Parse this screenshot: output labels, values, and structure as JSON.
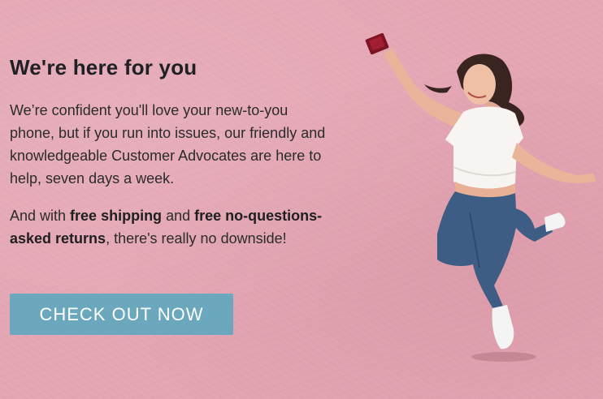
{
  "hero": {
    "heading": "We're here for you",
    "paragraph1": "We’re confident you'll love your new-to-you phone, but if you run into issues, our friendly and knowledgeable Customer Advocates are here to help, seven days a week.",
    "paragraph2": {
      "part1": "And with ",
      "bold1": "free shipping",
      "part2": " and ",
      "bold2": "free no-questions-asked returns",
      "part3": ", there's really no downside!"
    },
    "cta_label": "CHECK OUT NOW"
  },
  "image": {
    "semantic": "woman-jumping-taking-selfie-photo"
  },
  "colors": {
    "background": "#e4a5b3",
    "button": "#6ba8bd",
    "button_text": "#ffffff",
    "text": "#222222"
  }
}
